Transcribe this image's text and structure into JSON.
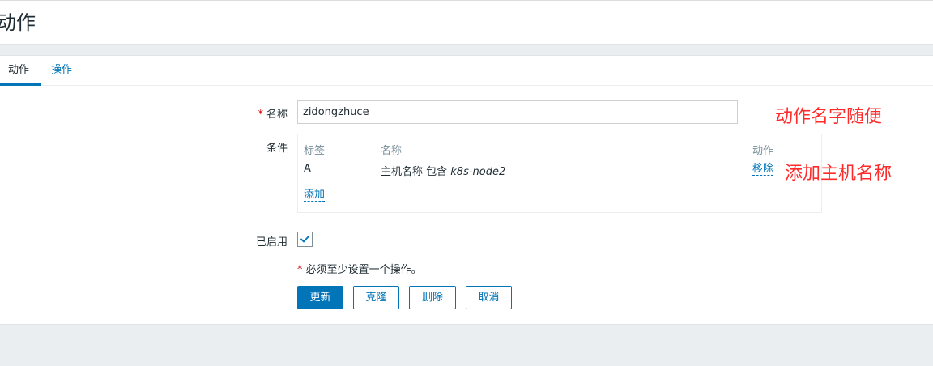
{
  "page": {
    "title": "动作"
  },
  "tabs": [
    {
      "label": "动作",
      "active": true
    },
    {
      "label": "操作",
      "active": false
    }
  ],
  "form": {
    "name": {
      "required_mark": "*",
      "label": "名称",
      "value": "zidongzhuce"
    },
    "conditions": {
      "label": "条件",
      "columns": {
        "tag": "标签",
        "name": "名称",
        "action": "动作"
      },
      "rows": [
        {
          "tag": "A",
          "name_prefix": "主机名称 包含 ",
          "name_value": "k8s-node2",
          "action": "移除"
        }
      ],
      "add_label": "添加"
    },
    "enabled": {
      "label": "已启用",
      "checked": true
    },
    "note": {
      "mark": "*",
      "text": " 必须至少设置一个操作。"
    }
  },
  "buttons": {
    "update": "更新",
    "clone": "克隆",
    "delete": "删除",
    "cancel": "取消"
  },
  "annotations": {
    "name_hint": "动作名字随便",
    "host_hint": "添加主机名称"
  },
  "colors": {
    "accent": "#0275b8",
    "required": "#d40000",
    "annotation": "#ff2a2a"
  }
}
